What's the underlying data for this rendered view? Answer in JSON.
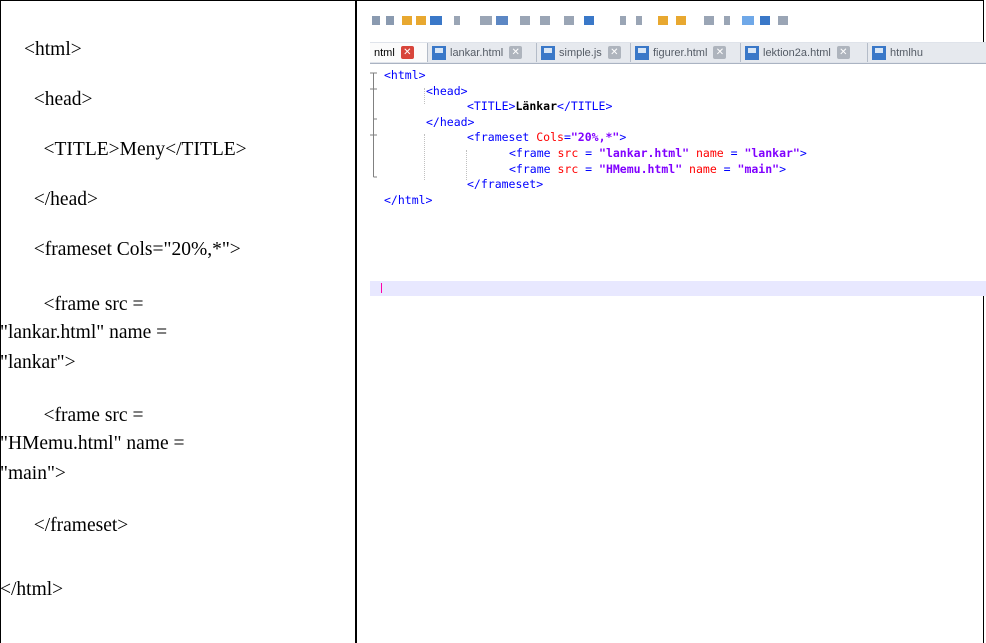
{
  "left_panel": {
    "lines": [
      "<html>",
      "  <head>",
      "    <TITLE>Meny</TITLE>",
      "  </head>",
      "  <frameset Cols=\"20%,*\">",
      "    <frame src =",
      "\"lankar.html\" name =",
      "\"lankar\">",
      "    <frame src =",
      "\"HMemu.html\" name =",
      "\"main\">",
      "  </frameset>",
      "</html>"
    ]
  },
  "editor": {
    "tabs": [
      {
        "label": "ntml",
        "active": true
      },
      {
        "label": "lankar.html",
        "active": false
      },
      {
        "label": "simple.js",
        "active": false
      },
      {
        "label": "figurer.html",
        "active": false
      },
      {
        "label": "lektion2a.html",
        "active": false
      },
      {
        "label": "htmlhu",
        "active": false
      }
    ],
    "close_glyph": "✕",
    "code": {
      "l1": "<html>",
      "l2": "<head>",
      "l3_open": "<TITLE>",
      "l3_text": "Länkar",
      "l3_close": "</TITLE>",
      "l4": "</head>",
      "l5_tag": "<frameset",
      "l5_attr": " Cols",
      "l5_eq": "=",
      "l5_val": "\"20%,*\"",
      "l5_end": ">",
      "l6_tag": "<frame",
      "l6_attr1": " src",
      "l6_eq1": " = ",
      "l6_val1": "\"lankar.html\"",
      "l6_attr2": " name",
      "l6_eq2": " = ",
      "l6_val2": "\"lankar\"",
      "l6_end": ">",
      "l7_tag": "<frame",
      "l7_attr1": " src",
      "l7_eq1": " = ",
      "l7_val1": "\"HMemu.html\"",
      "l7_attr2": " name",
      "l7_eq2": " = ",
      "l7_val2": "\"main\"",
      "l7_end": ">",
      "l8": "</frameset>",
      "l9": "</html>"
    }
  },
  "colors": {
    "tag": "#0000ff",
    "attribute": "#ff0000",
    "value": "#8000ff",
    "active_close": "#d8453b",
    "current_line": "#e8e8ff"
  }
}
